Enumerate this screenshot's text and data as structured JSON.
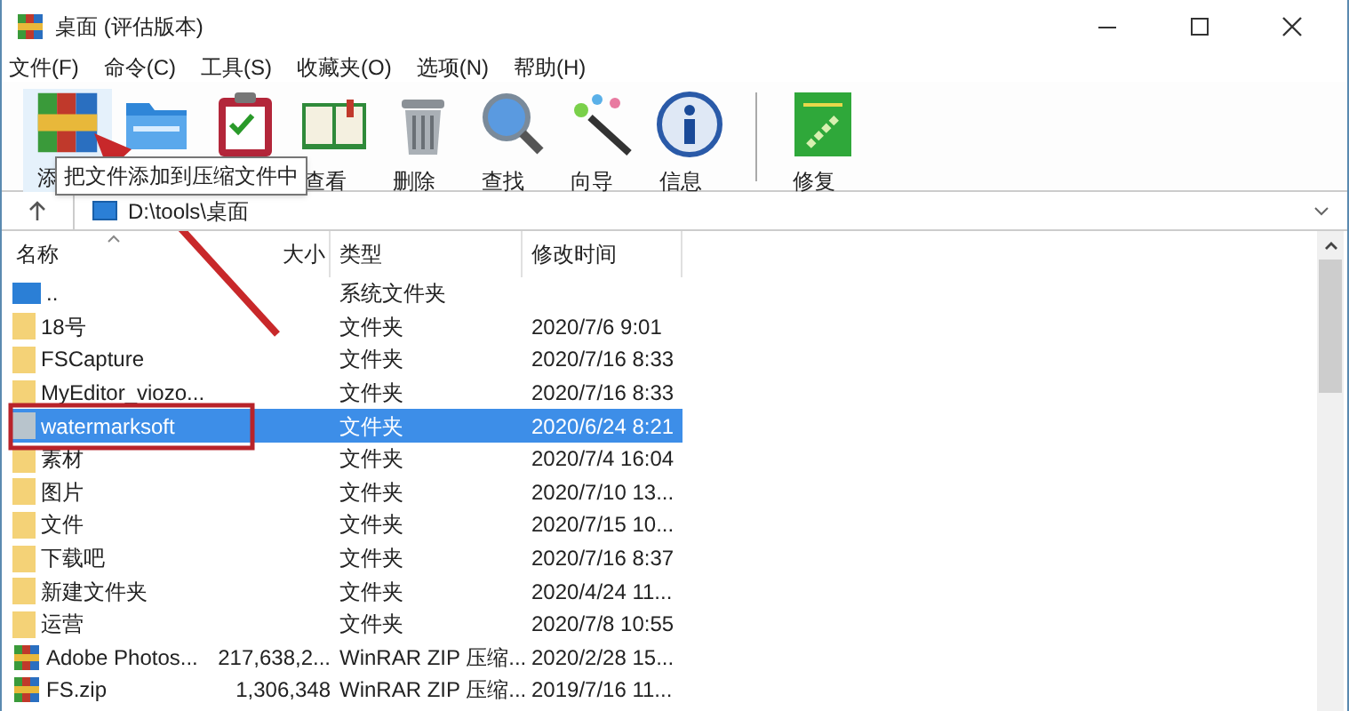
{
  "window": {
    "title": "桌面 (评估版本)"
  },
  "menu": [
    "文件(F)",
    "命令(C)",
    "工具(S)",
    "收藏夹(O)",
    "选项(N)",
    "帮助(H)"
  ],
  "toolbar": [
    {
      "kind": "add",
      "label": "添"
    },
    {
      "kind": "extract"
    },
    {
      "kind": "test"
    },
    {
      "kind": "view",
      "label": "查看"
    },
    {
      "kind": "delete",
      "label": "删除"
    },
    {
      "kind": "find",
      "label": "查找"
    },
    {
      "kind": "wizard",
      "label": "向导"
    },
    {
      "kind": "info",
      "label": "信息"
    },
    {
      "kind": "repair",
      "label": "修复",
      "separated": true
    }
  ],
  "tooltip": "把文件添加到压缩文件中",
  "address": "D:\\tools\\桌面",
  "columns": [
    "名称",
    "大小",
    "类型",
    "修改时间"
  ],
  "rows": [
    {
      "kind": "parent",
      "name": "..",
      "size": "",
      "type": "系统文件夹",
      "modified": "",
      "selected": false
    },
    {
      "kind": "folder",
      "name": "18号",
      "type": "文件夹",
      "modified": "2020/7/6 9:01",
      "selected": false
    },
    {
      "kind": "folder",
      "name": "FSCapture",
      "type": "文件夹",
      "modified": "2020/7/16 8:33",
      "selected": false
    },
    {
      "kind": "folder",
      "name": "MyEditor_viozo...",
      "type": "文件夹",
      "modified": "2020/7/16 8:33",
      "selected": false
    },
    {
      "kind": "folder",
      "name": "watermarksoft",
      "type": "文件夹",
      "modified": "2020/6/24 8:21",
      "selected": true
    },
    {
      "kind": "folder",
      "name": "素材",
      "type": "文件夹",
      "modified": "2020/7/4 16:04",
      "selected": false
    },
    {
      "kind": "folder",
      "name": "图片",
      "type": "文件夹",
      "modified": "2020/7/10 13...",
      "selected": false
    },
    {
      "kind": "folder",
      "name": "文件",
      "type": "文件夹",
      "modified": "2020/7/15 10...",
      "selected": false
    },
    {
      "kind": "folder",
      "name": "下载吧",
      "type": "文件夹",
      "modified": "2020/7/16 8:37",
      "selected": false
    },
    {
      "kind": "folder",
      "name": "新建文件夹",
      "type": "文件夹",
      "modified": "2020/4/24 11...",
      "selected": false
    },
    {
      "kind": "folder",
      "name": "运营",
      "type": "文件夹",
      "modified": "2020/7/8 10:55",
      "selected": false
    },
    {
      "kind": "archive",
      "name": "Adobe Photos...",
      "size": "217,638,2...",
      "type": "WinRAR ZIP 压缩...",
      "modified": "2020/2/28 15...",
      "selected": false
    },
    {
      "kind": "archive",
      "name": "FS.zip",
      "size": "1,306,348",
      "type": "WinRAR ZIP 压缩...",
      "modified": "2019/7/16 11...",
      "selected": false
    }
  ]
}
